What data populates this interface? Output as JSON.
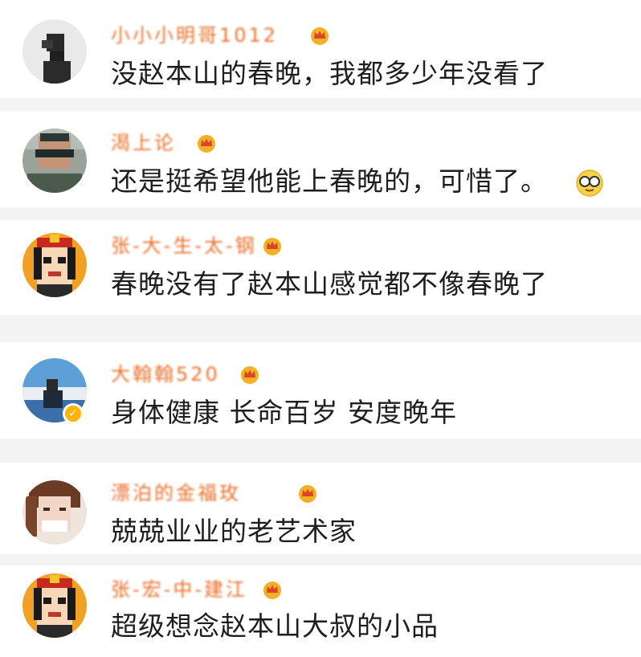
{
  "comments": [
    {
      "username": "小小小明哥1012",
      "text": "没赵本山的春晚，我都多少年没看了",
      "verified": false,
      "emoji": ""
    },
    {
      "username": "渴上论",
      "text": "还是挺希望他能上春晚的，可惜了。",
      "verified": false,
      "emoji": "sunglasses-face-emoji"
    },
    {
      "username": "张-大-生-太-钢",
      "text": "春晚没有了赵本山感觉都不像春晚了",
      "verified": false,
      "emoji": ""
    },
    {
      "username": "大翰翰520",
      "text": "身体健康 长命百岁 安度晚年",
      "verified": true,
      "emoji": ""
    },
    {
      "username": "漂泊的金福玫",
      "text": "兢兢业业的老艺术家",
      "verified": false,
      "emoji": ""
    },
    {
      "username": "张-宏-中-建江",
      "text": "超级想念赵本山大叔的小品",
      "verified": false,
      "emoji": ""
    }
  ],
  "colors": {
    "username": "#e8702a",
    "text": "#1e1e1e",
    "separator": "#f4f4f4",
    "crown_badge": "#f2b023",
    "verified_badge": "#ffb400"
  },
  "icons": {
    "member_badge": "crown-icon",
    "verified_badge": "verified-icon",
    "reaction_emoji": "sunglasses-face-emoji"
  }
}
